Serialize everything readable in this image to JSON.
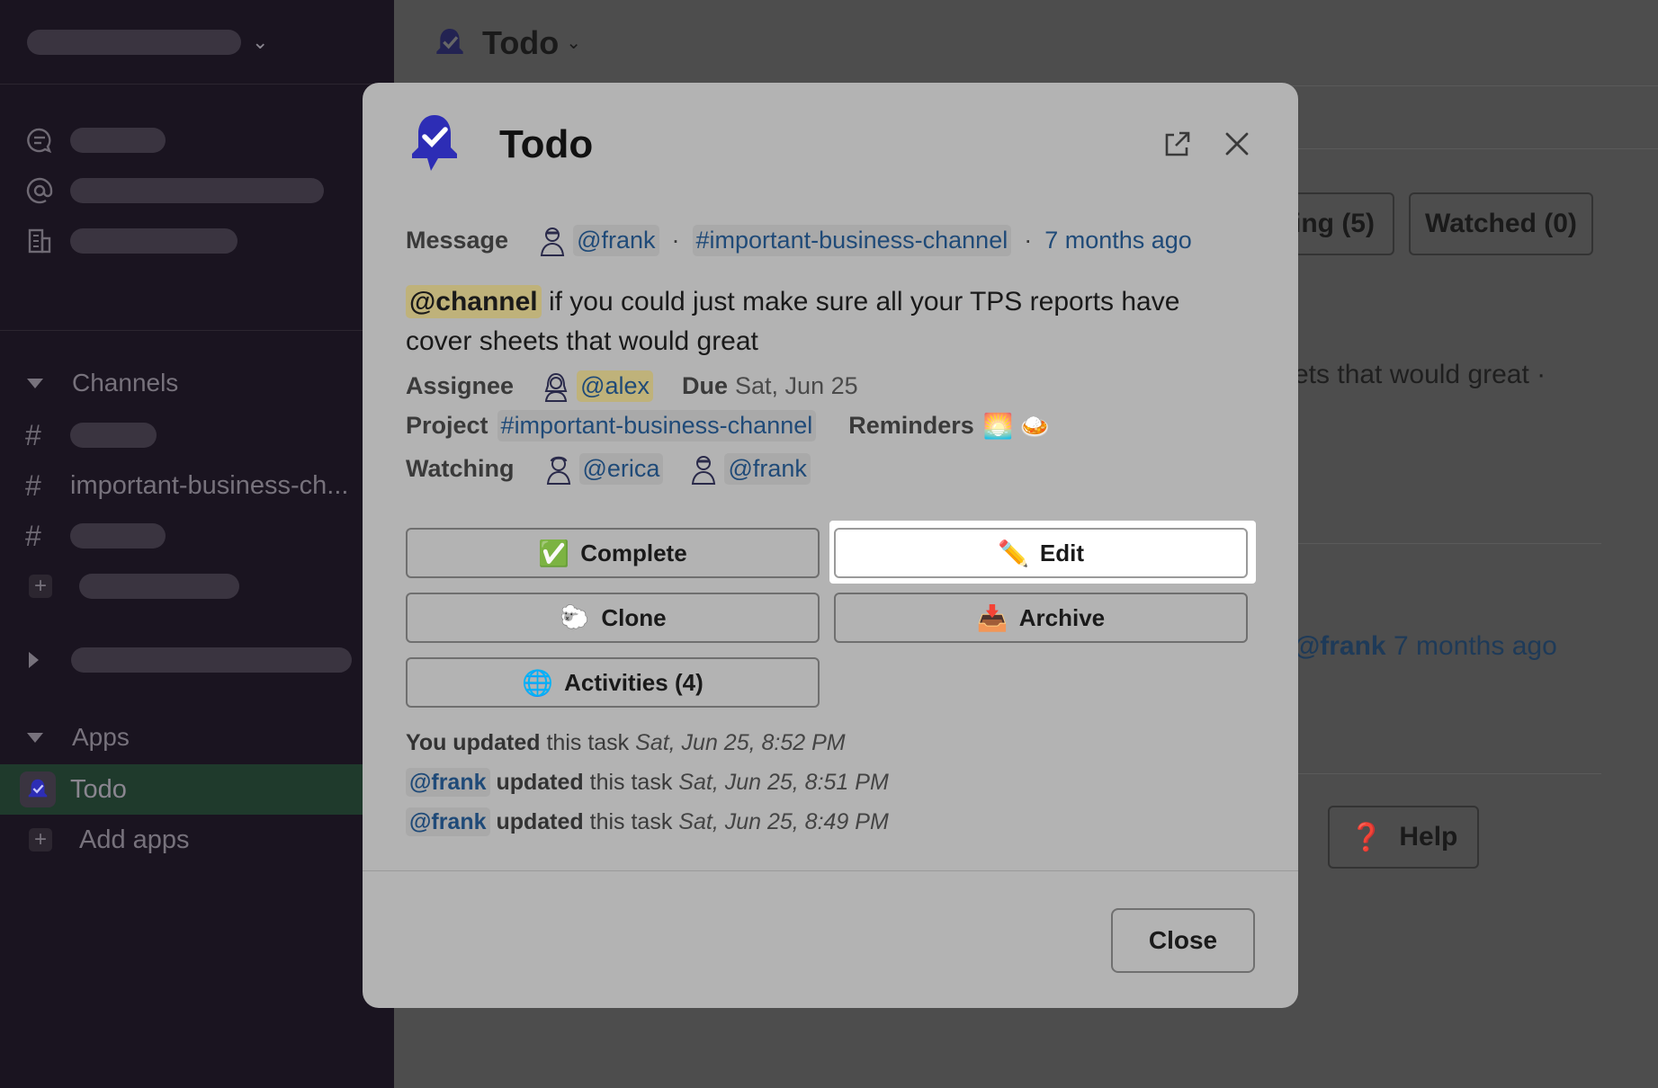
{
  "app": {
    "title": "Todo"
  },
  "sidebar": {
    "sections": {
      "channels": "Channels",
      "apps": "Apps"
    },
    "channels": [
      "important-business-ch..."
    ],
    "apps": {
      "todo": "Todo",
      "add": "Add apps"
    }
  },
  "background": {
    "pill_pending": "ing (5)",
    "pill_watched": "Watched (0)",
    "snippet": "ets that would great ·",
    "author": "@frank",
    "time": "7 months ago",
    "help": "Help"
  },
  "modal": {
    "title": "Todo",
    "message": {
      "label": "Message",
      "author": "@frank",
      "channel": "#important-business-channel",
      "time": "7 months ago",
      "mention": "@channel",
      "text": "if you could just make sure all your TPS reports have cover sheets that would great"
    },
    "assignee": {
      "label": "Assignee",
      "user": "@alex"
    },
    "due": {
      "label": "Due",
      "date": "Sat, Jun 25"
    },
    "project": {
      "label": "Project",
      "channel": "#important-business-channel"
    },
    "reminders": {
      "label": "Reminders",
      "icons": "🌅 🍛"
    },
    "watching": {
      "label": "Watching",
      "users": [
        "@erica",
        "@frank"
      ]
    },
    "buttons": {
      "complete": {
        "emoji": "✅",
        "label": "Complete"
      },
      "edit": {
        "emoji": "✏️",
        "label": "Edit"
      },
      "clone": {
        "emoji": "🐑",
        "label": "Clone"
      },
      "archive": {
        "emoji": "📥",
        "label": "Archive"
      },
      "activities": {
        "emoji": "🌐",
        "label": "Activities (4)"
      }
    },
    "activity": [
      {
        "actor": "You updated",
        "rest": "this task",
        "time": "Sat, Jun 25, 8:52 PM"
      },
      {
        "actor": "@frank",
        "verb": "updated",
        "rest": "this task",
        "time": "Sat, Jun 25, 8:51 PM"
      },
      {
        "actor": "@frank",
        "verb": "updated",
        "rest": "this task",
        "time": "Sat, Jun 25, 8:49 PM"
      }
    ],
    "close_label": "Close"
  },
  "colors": {
    "brand": "#2d2db5",
    "link": "#1f4a78",
    "highlight": "#bfb27a"
  }
}
